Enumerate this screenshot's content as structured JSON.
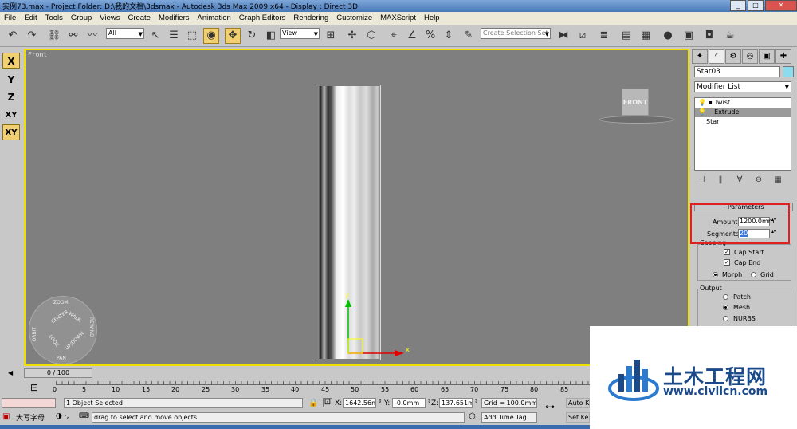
{
  "window": {
    "title": "实例73.max    - Project Folder: D:\\我的文档\\3dsmax    - Autodesk 3ds Max  2009 x64        - Display : Direct 3D",
    "minimize": "_",
    "maximize": "□",
    "close": "✕"
  },
  "menu": [
    "File",
    "Edit",
    "Tools",
    "Group",
    "Views",
    "Create",
    "Modifiers",
    "Animation",
    "Graph Editors",
    "Rendering",
    "Customize",
    "MAXScript",
    "Help"
  ],
  "toolbar": {
    "selection_filter": "All",
    "ref_coord": "View",
    "named_selection": "Create Selection Set"
  },
  "axis_buttons": [
    "X",
    "Y",
    "Z",
    "XY",
    "XY"
  ],
  "viewport": {
    "label": "Front",
    "viewcube_face": "FRONT",
    "wheel": [
      "ZOOM",
      "ORBIT",
      "CENTER",
      "WALK",
      "REWIND",
      "LOOK",
      "UP/DOWN",
      "PAN"
    ]
  },
  "command_panel": {
    "object_name": "Star03",
    "object_color": "#8cdcf0",
    "modifier_list": "Modifier List",
    "stack": [
      "Twist",
      "Extrude",
      "Star"
    ],
    "selected_stack_item": "Extrude",
    "rollout_title": "Parameters",
    "amount_label": "Amount:",
    "amount_value": "1200.0mm",
    "segments_label": "Segments:",
    "segments_value": "20",
    "capping_label": "Capping",
    "cap_start": "Cap Start",
    "cap_end": "Cap End",
    "morph": "Morph",
    "grid": "Grid",
    "output_label": "Output",
    "patch": "Patch",
    "mesh": "Mesh",
    "nurbs": "NURBS"
  },
  "timeline": {
    "frame": "0 / 100",
    "ticks": [
      "0",
      "5",
      "10",
      "15",
      "20",
      "25",
      "30",
      "35",
      "40",
      "45",
      "50",
      "55",
      "60",
      "65",
      "70",
      "75",
      "80",
      "85"
    ]
  },
  "status": {
    "selection": "1 Object Selected",
    "prompt": "drag to select and move objects",
    "x_label": "X:",
    "x_value": "1642.56mm",
    "y_label": "Y:",
    "y_value": "-0.0mm",
    "z_label": "Z:",
    "z_value": "137.651mm",
    "grid": "Grid = 100.0mm",
    "add_time_tag": "Add Time Tag",
    "auto_key": "Auto Ke",
    "set_key": "Set Ke",
    "ime": "大写字母"
  },
  "watermark": {
    "name": "土木工程网",
    "url": "www.civilcn.com"
  }
}
